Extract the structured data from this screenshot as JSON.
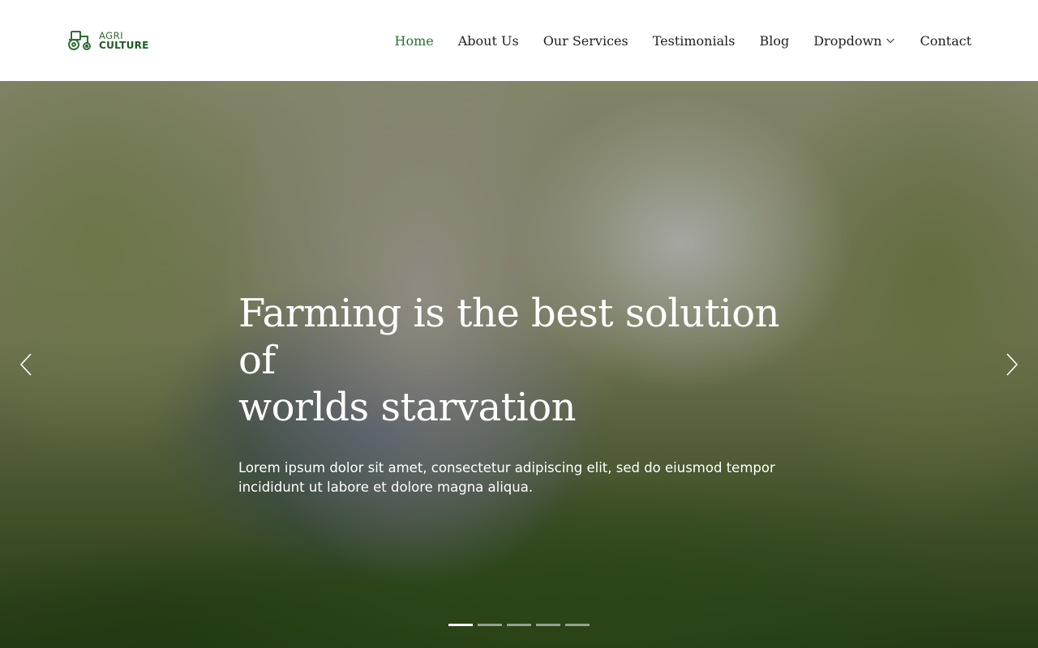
{
  "brand": {
    "logo_icon": "tractor-icon",
    "top": "AGRI",
    "bottom": "CULTURE",
    "color": "#2e6e35"
  },
  "nav": {
    "items": [
      {
        "label": "Home",
        "active": true
      },
      {
        "label": "About Us"
      },
      {
        "label": "Our Services"
      },
      {
        "label": "Testimonials"
      },
      {
        "label": "Blog"
      },
      {
        "label": "Dropdown",
        "icon": "chevron-down-icon"
      },
      {
        "label": "Contact"
      }
    ],
    "active_color": "#2e6e35"
  },
  "hero": {
    "title_line1": "Farming is the best solution of",
    "title_line2": "worlds starvation",
    "text": "Lorem ipsum dolor sit amet, consectetur adipiscing elit, sed do eiusmod tempor incididunt ut labore et dolore magna aliqua.",
    "prev_icon": "chevron-left-icon",
    "next_icon": "chevron-right-icon",
    "slide_count": 5,
    "active_slide": 1
  }
}
